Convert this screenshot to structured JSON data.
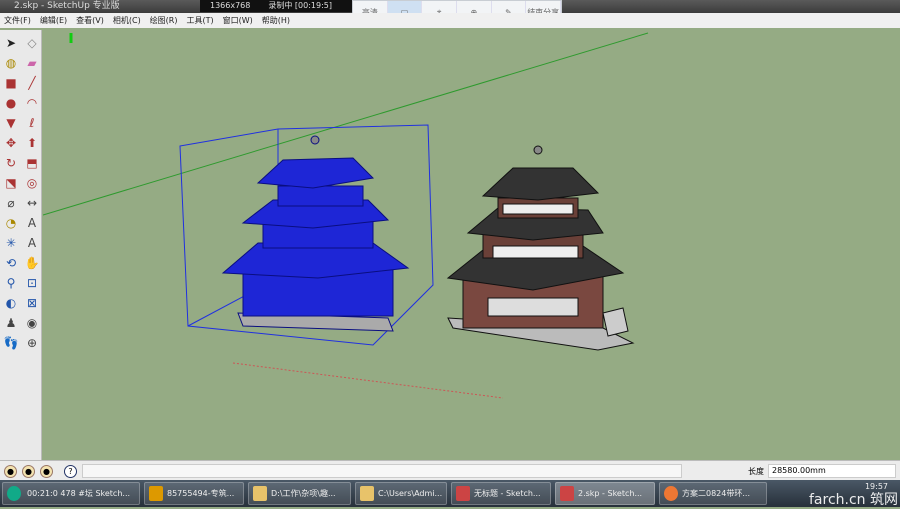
{
  "window": {
    "title": "2.skp - SketchUp 专业版"
  },
  "recorder": {
    "resolution": "1366x768",
    "status": "录制中 [00:19:5]"
  },
  "share_bar": {
    "items": [
      "高清",
      "",
      "",
      "",
      "",
      "结束分享"
    ]
  },
  "menu": [
    "文件(F)",
    "编辑(E)",
    "查看(V)",
    "相机(C)",
    "绘图(R)",
    "工具(T)",
    "窗口(W)",
    "帮助(H)"
  ],
  "status": {
    "help": "?",
    "length_label": "长度",
    "length_value": "28580.00mm"
  },
  "taskbar": {
    "timer": "00:21:0",
    "items": [
      "478 #坛 Sketch...",
      "85755494-专筑...",
      "D:\\工作\\杂项\\趣...",
      "C:\\Users\\Admi...",
      "无标题 - Sketch...",
      "2.skp - Sketch...",
      "方案二0824带环..."
    ],
    "clock": "19:57",
    "watermark": "farch.cn 筑网"
  },
  "colors": {
    "canvas": "#95ab84",
    "selection": "#1f2ad8"
  }
}
